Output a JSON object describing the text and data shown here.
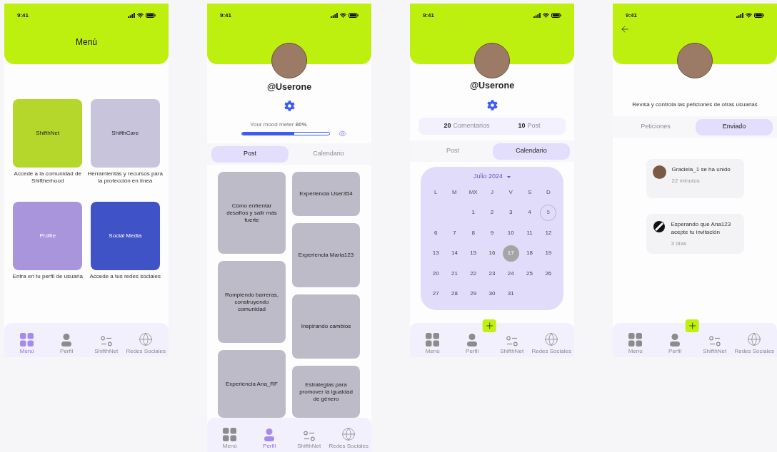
{
  "screens": [
    {
      "kind": "menu",
      "status": {
        "time": "9:41"
      },
      "title": "Menú",
      "cards": [
        {
          "label": "ShifthNet",
          "caption": "Accede a la comunidad de Shiftherhood",
          "color": "#b5d62a"
        },
        {
          "label": "ShifthCare",
          "caption": "Herramientas y recursos para la protección en línea",
          "color": "#c8c4dc"
        },
        {
          "label": "Profile",
          "caption": "Entra en tu perfil de usuaria",
          "color": "#a995dc"
        },
        {
          "label": "Social Media",
          "caption": "Accede a tus redes sociales",
          "color": "#3f52c6"
        }
      ],
      "nav": {
        "plus": false,
        "items": [
          {
            "label": "Menú",
            "selected": true
          },
          {
            "label": "Perfil",
            "selected": false
          },
          {
            "label": "ShifthNet",
            "selected": false
          },
          {
            "label": "Redes Sociales",
            "selected": false
          }
        ]
      }
    },
    {
      "kind": "profile_posts",
      "status": {
        "time": "9:41"
      },
      "username": "@Userone",
      "mood": {
        "label": "Your mood meter **60%**",
        "level": 0.6
      },
      "tabs": [
        {
          "label": "Post",
          "selected": true
        },
        {
          "label": "Calendario",
          "selected": false
        }
      ],
      "columns": [
        [
          {
            "title": "Cómo enfrentar desafíos y salir más fuerte",
            "kind": "tall"
          },
          {
            "title": "Rompiendo barreras, construyendo comunidad",
            "kind": "tall"
          },
          {
            "title": "Experiencia Ana_RF",
            "kind": "rest"
          }
        ],
        [
          {
            "title": "Experiencia User354",
            "kind": "short"
          },
          {
            "title": "Experiencia Maria123",
            "kind": "medium"
          },
          {
            "title": "Inspirando cambios",
            "kind": "medium"
          },
          {
            "title": "Estrategias para promover la igualdad de género",
            "kind": "rest"
          }
        ]
      ],
      "nav": {
        "plus": false,
        "items": [
          {
            "label": "Menú",
            "selected": false
          },
          {
            "label": "Perfil",
            "selected": true
          },
          {
            "label": "ShifthNet",
            "selected": false
          },
          {
            "label": "Redes Sociales",
            "selected": false
          }
        ]
      }
    },
    {
      "kind": "profile_calendar",
      "status": {
        "time": "9:41"
      },
      "username": "@Userone",
      "stats": [
        {
          "count": "20",
          "label": "Comentarios"
        },
        {
          "count": "10",
          "label": "Post"
        }
      ],
      "tabs": [
        {
          "label": "Post",
          "selected": false
        },
        {
          "label": "Calendario",
          "selected": true
        }
      ],
      "calendar": {
        "month": "Julio 2024",
        "weekdays": [
          "L",
          "M",
          "MX",
          "J",
          "V",
          "S",
          "D"
        ],
        "weeks": [
          [
            {
              "label": "1",
              "selected": false,
              "circled": false
            },
            {
              "label": "2",
              "selected": false,
              "circled": false
            },
            {
              "label": "3",
              "selected": false,
              "circled": false
            },
            {
              "label": "4",
              "selected": false,
              "circled": false
            },
            {
              "label": "5",
              "selected": false,
              "circled": true
            }
          ],
          [
            {
              "label": "6",
              "selected": false,
              "circled": false
            },
            {
              "label": "7",
              "selected": false,
              "circled": false
            },
            {
              "label": "8",
              "selected": false,
              "circled": false
            },
            {
              "label": "9",
              "selected": false,
              "circled": false
            },
            {
              "label": "10",
              "selected": false,
              "circled": false
            },
            {
              "label": "11",
              "selected": false,
              "circled": false
            },
            {
              "label": "12",
              "selected": false,
              "circled": false
            }
          ],
          [
            {
              "label": "13",
              "selected": false,
              "circled": false
            },
            {
              "label": "14",
              "selected": false,
              "circled": false
            },
            {
              "label": "15",
              "selected": false,
              "circled": false
            },
            {
              "label": "16",
              "selected": false,
              "circled": false
            },
            {
              "label": "17",
              "selected": true,
              "circled": false
            },
            {
              "label": "18",
              "selected": false,
              "circled": false
            },
            {
              "label": "19",
              "selected": false,
              "circled": false
            }
          ],
          [
            {
              "label": "20",
              "selected": false,
              "circled": false
            },
            {
              "label": "21",
              "selected": false,
              "circled": false
            },
            {
              "label": "22",
              "selected": false,
              "circled": false
            },
            {
              "label": "23",
              "selected": false,
              "circled": false
            },
            {
              "label": "24",
              "selected": false,
              "circled": false
            },
            {
              "label": "25",
              "selected": false,
              "circled": false
            },
            {
              "label": "26",
              "selected": false,
              "circled": false
            }
          ],
          [
            {
              "label": "27",
              "selected": false,
              "circled": false
            },
            {
              "label": "28",
              "selected": false,
              "circled": false
            },
            {
              "label": "29",
              "selected": false,
              "circled": false
            },
            {
              "label": "30",
              "selected": false,
              "circled": false
            },
            {
              "label": "31",
              "selected": false,
              "circled": false
            }
          ]
        ]
      },
      "nav": {
        "plus": true,
        "items": [
          {
            "label": "Menú",
            "selected": false
          },
          {
            "label": "Perfil",
            "selected": false
          },
          {
            "label": "ShifthNet",
            "selected": false
          },
          {
            "label": "Redes Sociales",
            "selected": false
          }
        ]
      }
    },
    {
      "kind": "requests",
      "status": {
        "time": "9:41"
      },
      "intro": "Revisa y controla las peticiones de otras usuarias",
      "tabs": [
        {
          "label": "Peticiones",
          "selected": false
        },
        {
          "label": "Enviado",
          "selected": true
        }
      ],
      "notifications": [
        {
          "text": "Graciela_1 se ha unido",
          "time": "22 minutos"
        },
        {
          "text": "Esperando que Ana123 acepte tu invitación",
          "time": "3 días"
        }
      ],
      "nav": {
        "plus": true,
        "items": [
          {
            "label": "Menú",
            "selected": false
          },
          {
            "label": "Perfil",
            "selected": false
          },
          {
            "label": "ShifthNet",
            "selected": false
          },
          {
            "label": "Redes Sociales",
            "selected": false
          }
        ]
      }
    }
  ]
}
